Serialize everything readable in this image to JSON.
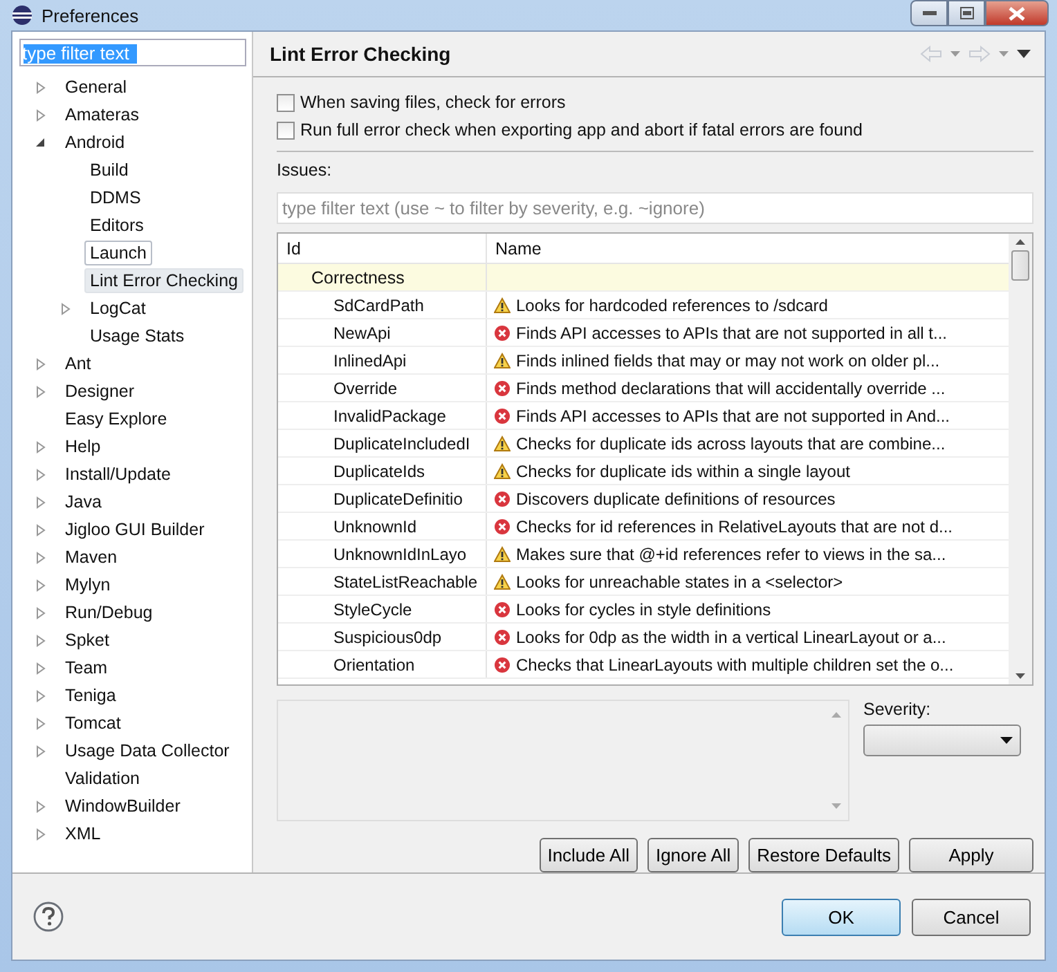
{
  "window": {
    "title": "Preferences"
  },
  "sidebar": {
    "filter": {
      "value": "type filter text"
    },
    "items": [
      {
        "label": "General",
        "kind": "collapsed",
        "selected": false
      },
      {
        "label": "Amateras",
        "kind": "collapsed",
        "selected": false
      },
      {
        "label": "Android",
        "kind": "expanded",
        "selected": false,
        "children": [
          {
            "label": "Build",
            "kind": "leaf",
            "selected": false,
            "focused": false
          },
          {
            "label": "DDMS",
            "kind": "leaf",
            "selected": false,
            "focused": false
          },
          {
            "label": "Editors",
            "kind": "leaf",
            "selected": false,
            "focused": false
          },
          {
            "label": "Launch",
            "kind": "leaf",
            "selected": false,
            "focused": true
          },
          {
            "label": "Lint Error Checking",
            "kind": "leaf",
            "selected": true,
            "focused": false
          },
          {
            "label": "LogCat",
            "kind": "collapsed",
            "selected": false,
            "focused": false
          },
          {
            "label": "Usage Stats",
            "kind": "leaf",
            "selected": false,
            "focused": false
          }
        ]
      },
      {
        "label": "Ant",
        "kind": "collapsed",
        "selected": false
      },
      {
        "label": "Designer",
        "kind": "collapsed",
        "selected": false
      },
      {
        "label": "Easy Explore",
        "kind": "leaf",
        "selected": false
      },
      {
        "label": "Help",
        "kind": "collapsed",
        "selected": false
      },
      {
        "label": "Install/Update",
        "kind": "collapsed",
        "selected": false
      },
      {
        "label": "Java",
        "kind": "collapsed",
        "selected": false
      },
      {
        "label": "Jigloo GUI Builder",
        "kind": "collapsed",
        "selected": false
      },
      {
        "label": "Maven",
        "kind": "collapsed",
        "selected": false
      },
      {
        "label": "Mylyn",
        "kind": "collapsed",
        "selected": false
      },
      {
        "label": "Run/Debug",
        "kind": "collapsed",
        "selected": false
      },
      {
        "label": "Spket",
        "kind": "collapsed",
        "selected": false
      },
      {
        "label": "Team",
        "kind": "collapsed",
        "selected": false
      },
      {
        "label": "Teniga",
        "kind": "collapsed",
        "selected": false
      },
      {
        "label": "Tomcat",
        "kind": "collapsed",
        "selected": false
      },
      {
        "label": "Usage Data Collector",
        "kind": "collapsed",
        "selected": false
      },
      {
        "label": "Validation",
        "kind": "leaf",
        "selected": false
      },
      {
        "label": "WindowBuilder",
        "kind": "collapsed",
        "selected": false
      },
      {
        "label": "XML",
        "kind": "collapsed",
        "selected": false
      }
    ]
  },
  "page": {
    "title": "Lint Error Checking",
    "options": [
      {
        "label": "When saving files, check for errors",
        "checked": false
      },
      {
        "label": "Run full error check when exporting app and abort if fatal errors are found",
        "checked": false
      }
    ],
    "issues_label": "Issues:",
    "issues_filter": {
      "placeholder": "type filter text (use ~ to filter by severity, e.g. ~ignore)"
    },
    "table": {
      "columns": [
        "Id",
        "Name"
      ],
      "rows": [
        {
          "kind": "category",
          "id": "Correctness"
        },
        {
          "kind": "warning",
          "id": "SdCardPath",
          "name": "Looks for hardcoded references to /sdcard"
        },
        {
          "kind": "error",
          "id": "NewApi",
          "name": "Finds API accesses to APIs that are not supported in all t..."
        },
        {
          "kind": "warning",
          "id": "InlinedApi",
          "name": "Finds inlined fields that may or may not work on older pl..."
        },
        {
          "kind": "error",
          "id": "Override",
          "name": "Finds method declarations that will accidentally override ..."
        },
        {
          "kind": "error",
          "id": "InvalidPackage",
          "name": "Finds API accesses to APIs that are not supported in And..."
        },
        {
          "kind": "warning",
          "id": "DuplicateIncludedI",
          "name": "Checks for duplicate ids across layouts that are combine..."
        },
        {
          "kind": "warning",
          "id": "DuplicateIds",
          "name": "Checks for duplicate ids within a single layout"
        },
        {
          "kind": "error",
          "id": "DuplicateDefinitio",
          "name": "Discovers duplicate definitions of resources"
        },
        {
          "kind": "error",
          "id": "UnknownId",
          "name": "Checks for id references in RelativeLayouts that are not d..."
        },
        {
          "kind": "warning",
          "id": "UnknownIdInLayo",
          "name": "Makes sure that @+id references refer to views in the sa..."
        },
        {
          "kind": "warning",
          "id": "StateListReachable",
          "name": "Looks for unreachable states in a <selector>"
        },
        {
          "kind": "error",
          "id": "StyleCycle",
          "name": "Looks for cycles in style definitions"
        },
        {
          "kind": "error",
          "id": "Suspicious0dp",
          "name": "Looks for 0dp as the width in a vertical LinearLayout or a..."
        },
        {
          "kind": "error",
          "id": "Orientation",
          "name": "Checks that LinearLayouts with multiple children set the o..."
        }
      ]
    },
    "severity_label": "Severity:",
    "buttons": [
      "Include All",
      "Ignore All",
      "Restore Defaults",
      "Apply"
    ]
  },
  "dialog_buttons": [
    {
      "label": "OK",
      "default": true
    },
    {
      "label": "Cancel",
      "default": false
    }
  ]
}
